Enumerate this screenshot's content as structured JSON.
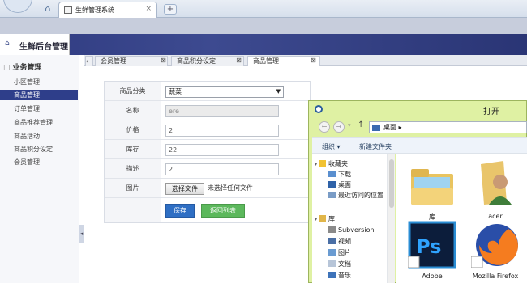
{
  "browser": {
    "tab_title": "生鲜管理系统",
    "tab_close": "×",
    "new_tab": "+"
  },
  "app": {
    "title": "生鲜后台管理"
  },
  "sidebar": {
    "group": "业务管理",
    "items": [
      {
        "label": "小区管理",
        "active": false
      },
      {
        "label": "商品管理",
        "active": true
      },
      {
        "label": "订单管理",
        "active": false
      },
      {
        "label": "商品推荐管理",
        "active": false
      },
      {
        "label": "商品活动",
        "active": false
      },
      {
        "label": "商品积分设定",
        "active": false
      },
      {
        "label": "会员管理",
        "active": false
      }
    ]
  },
  "content_tabs": [
    {
      "label": "会员管理",
      "active": false
    },
    {
      "label": "商品积分设定",
      "active": false
    },
    {
      "label": "商品管理",
      "active": true
    }
  ],
  "form": {
    "category": {
      "label": "商品分类",
      "value": "蔬菜"
    },
    "name": {
      "label": "名称",
      "value": "ere"
    },
    "price": {
      "label": "价格",
      "value": "2"
    },
    "stock": {
      "label": "库存",
      "value": "22"
    },
    "description": {
      "label": "描述",
      "value": "2"
    },
    "image": {
      "label": "图片",
      "button": "选择文件",
      "status": "未选择任何文件"
    },
    "save_button": "保存",
    "back_button": "返回列表"
  },
  "dialog": {
    "title": "打开",
    "address_crumb": "桌面",
    "toolbar": {
      "organize": "组织 ▾",
      "new_folder": "新建文件夹"
    },
    "nav": {
      "favorites": "收藏夹",
      "download": "下载",
      "desktop": "桌面",
      "recent": "最近访问的位置",
      "library": "库",
      "subversion": "Subversion",
      "video": "视频",
      "pictures": "图片",
      "documents": "文档",
      "music": "音乐"
    },
    "files": [
      "库",
      "acer",
      "Adobe",
      "Mozilla Firefox"
    ]
  },
  "colors": {
    "header": "#2f3b80",
    "active_nav": "#2e3e8a",
    "dialog_frame": "#dff1a3",
    "save_button": "#2f6fc4",
    "back_button": "#5cb85c"
  }
}
